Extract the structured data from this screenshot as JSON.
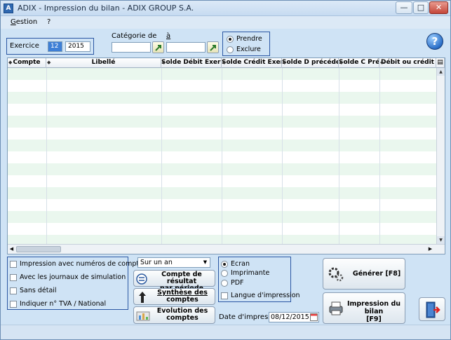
{
  "window": {
    "icon_letter": "A",
    "title": "ADIX - Impression du bilan - ADIX GROUP S.A.",
    "minimize": "—",
    "maximize": "□",
    "close": "✕"
  },
  "menu": [
    {
      "label": "Gestion",
      "accel": "G",
      "rest": "estion"
    },
    {
      "label": "?"
    }
  ],
  "exercice": {
    "label": "Exercice",
    "month": "12",
    "year": "2015"
  },
  "categorie": {
    "label_de": "Catégorie de",
    "label_a": "à",
    "from": "",
    "to": ""
  },
  "filter": {
    "options": [
      {
        "label": "Prendre",
        "selected": true
      },
      {
        "label": "Exclure",
        "selected": false
      }
    ]
  },
  "help_icon": "?",
  "grid": {
    "columns": [
      "Compte",
      "Libellé",
      "Solde Débit Exercice",
      "Solde Crédit Exercice",
      "Solde D précédent",
      "Solde C Préc",
      "Débit ou crédit"
    ],
    "rows": 15
  },
  "options": [
    {
      "label": "Impression avec numéros de comptes",
      "checked": false
    },
    {
      "label": "Avec les journaux de simulation",
      "checked": false
    },
    {
      "label": "Sans détail",
      "checked": false
    },
    {
      "label": "Indiquer n° TVA / National",
      "checked": false
    }
  ],
  "period_select": {
    "value": "Sur un an"
  },
  "buttons": {
    "compte_resultat": [
      "Compte de résultat",
      "par période"
    ],
    "synthese": [
      "Synthèse des",
      "comptes"
    ],
    "evolution": [
      "Evolution des",
      "comptes"
    ],
    "generer": "Générer  [F8]",
    "impression": [
      "Impression du bilan",
      "[F9]"
    ]
  },
  "output": {
    "options": [
      {
        "label": "Ecran",
        "selected": true
      },
      {
        "label": "Imprimante",
        "selected": false
      },
      {
        "label": "PDF",
        "selected": false
      }
    ],
    "langue_label": "Langue d'impression",
    "langue_checked": false
  },
  "date_impression": {
    "label": "Date d'impression",
    "value": "08/12/2015"
  }
}
